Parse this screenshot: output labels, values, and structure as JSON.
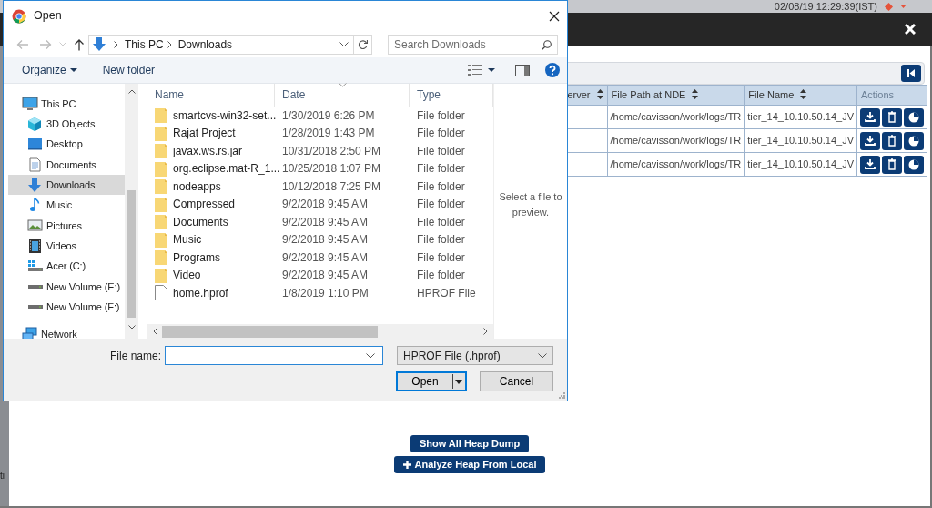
{
  "app": {
    "datetime": "02/08/19 12:29:39(IST)",
    "table": {
      "columns": [
        {
          "label": "erver",
          "sortable": true
        },
        {
          "label": "File Path at NDE",
          "sortable": true
        },
        {
          "label": "File Name",
          "sortable": true
        },
        {
          "label": "Actions",
          "sortable": false
        }
      ],
      "rows": [
        {
          "file_path": "/home/cavisson/work/logs/TR",
          "file_name": "tier_14_10.10.50.14_JV"
        },
        {
          "file_path": "/home/cavisson/work/logs/TR",
          "file_name": "tier_14_10.10.50.14_JV"
        },
        {
          "file_path": "/home/cavisson/work/logs/TR",
          "file_name": "tier_14_10.10.50.14_JV"
        }
      ]
    },
    "buttons": [
      {
        "label": "Show All Heap Dump",
        "kind": "plain"
      },
      {
        "label": "Analyze Heap From Local",
        "kind": "add"
      }
    ],
    "edge_text": "ti"
  },
  "dialog": {
    "title": "Open",
    "path": [
      "This PC",
      "Downloads"
    ],
    "search": {
      "placeholder": "Search Downloads"
    },
    "toolbar": [
      {
        "label": "Organize",
        "kind": "menu"
      },
      {
        "label": "New folder",
        "kind": "plain"
      }
    ],
    "sidebar": [
      {
        "label": "This PC",
        "kind": "pc",
        "selected": false,
        "children": [
          {
            "label": "3D Objects",
            "kind": "cube",
            "selected": false
          },
          {
            "label": "Desktop",
            "kind": "desktop",
            "selected": false
          },
          {
            "label": "Documents",
            "kind": "document",
            "selected": false
          },
          {
            "label": "Downloads",
            "kind": "download",
            "selected": true
          },
          {
            "label": "Music",
            "kind": "music",
            "selected": false
          },
          {
            "label": "Pictures",
            "kind": "pictures",
            "selected": false
          },
          {
            "label": "Videos",
            "kind": "video",
            "selected": false
          },
          {
            "label": "Acer (C:)",
            "kind": "system-drive",
            "selected": false
          },
          {
            "label": "New Volume (E:)",
            "kind": "drive",
            "selected": false
          },
          {
            "label": "New Volume (F:)",
            "kind": "drive",
            "selected": false
          }
        ]
      },
      {
        "label": "Network",
        "kind": "network",
        "selected": false
      }
    ],
    "columns": [
      "Name",
      "Date",
      "Type"
    ],
    "files": [
      {
        "name": "smartcvs-win32-set...",
        "date": "1/30/2019 6:26 PM",
        "type": "File folder",
        "kind": "folder"
      },
      {
        "name": "Rajat Project",
        "date": "1/28/2019 1:43 PM",
        "type": "File folder",
        "kind": "folder"
      },
      {
        "name": "javax.ws.rs.jar",
        "date": "10/31/2018 2:50 PM",
        "type": "File folder",
        "kind": "folder"
      },
      {
        "name": "org.eclipse.mat-R_1...",
        "date": "10/25/2018 1:07 PM",
        "type": "File folder",
        "kind": "folder"
      },
      {
        "name": "nodeapps",
        "date": "10/12/2018 7:25 PM",
        "type": "File folder",
        "kind": "folder"
      },
      {
        "name": "Compressed",
        "date": "9/2/2018 9:45 AM",
        "type": "File folder",
        "kind": "folder"
      },
      {
        "name": "Documents",
        "date": "9/2/2018 9:45 AM",
        "type": "File folder",
        "kind": "folder"
      },
      {
        "name": "Music",
        "date": "9/2/2018 9:45 AM",
        "type": "File folder",
        "kind": "folder"
      },
      {
        "name": "Programs",
        "date": "9/2/2018 9:45 AM",
        "type": "File folder",
        "kind": "folder"
      },
      {
        "name": "Video",
        "date": "9/2/2018 9:45 AM",
        "type": "File folder",
        "kind": "folder"
      },
      {
        "name": "home.hprof",
        "date": "1/8/2019 1:10 PM",
        "type": "HPROF File",
        "kind": "file"
      }
    ],
    "preview_text": "Select a file to preview.",
    "file_name_label": "File name:",
    "file_type": "HPROF File (.hprof)",
    "buttons": [
      {
        "label": "Open",
        "kind": "split"
      },
      {
        "label": "Cancel",
        "kind": "plain"
      }
    ]
  }
}
